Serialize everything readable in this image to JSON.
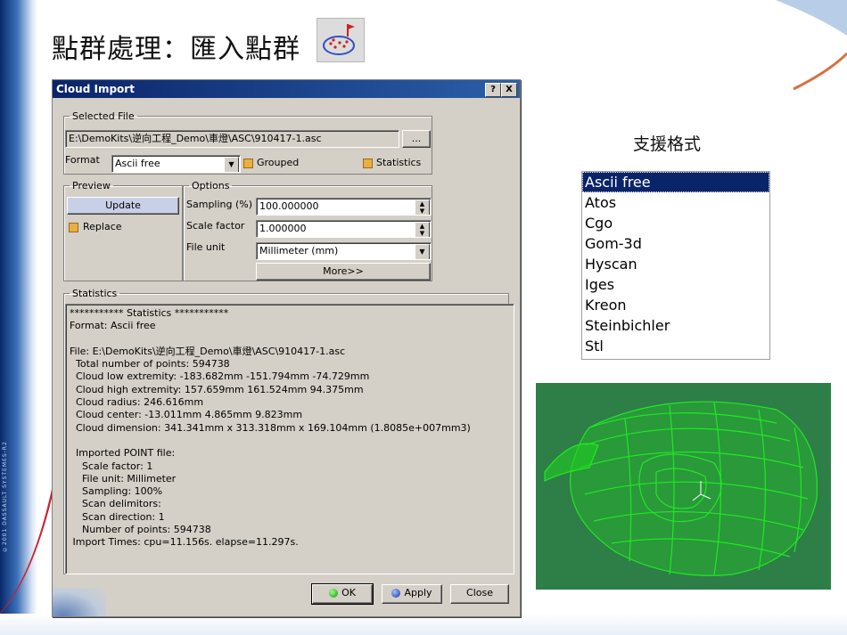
{
  "slide": {
    "title": "點群處理：匯入點群",
    "side_text": "©2001 DASSAULT SYSTEMES-R2"
  },
  "dialog": {
    "title": "Cloud Import",
    "help_label": "?",
    "close_label": "X",
    "selected_file": {
      "legend": "Selected File",
      "path": "E:\\DemoKits\\逆向工程_Demo\\車燈\\ASC\\910417-1.asc",
      "browse_label": "...",
      "format_label": "Format",
      "format_value": "Ascii free",
      "grouped_label": "Grouped",
      "statistics_label": "Statistics"
    },
    "preview": {
      "legend": "Preview",
      "update_label": "Update",
      "replace_label": "Replace"
    },
    "options": {
      "legend": "Options",
      "sampling_label": "Sampling (%)",
      "sampling_value": "100.000000",
      "scale_label": "Scale factor",
      "scale_value": "1.000000",
      "unit_label": "File unit",
      "unit_value": "Millimeter (mm)",
      "more_label": "More>>"
    },
    "statistics": {
      "legend": "Statistics",
      "text": "*********** Statistics ***********\nFormat: Ascii free\n\nFile: E:\\DemoKits\\逆向工程_Demo\\車燈\\ASC\\910417-1.asc\n  Total number of points: 594738\n  Cloud low extremity: -183.682mm -151.794mm -74.729mm\n  Cloud high extremity: 157.659mm 161.524mm 94.375mm\n  Cloud radius: 246.616mm\n  Cloud center: -13.011mm 4.865mm 9.823mm\n  Cloud dimension: 341.341mm x 313.318mm x 169.104mm (1.8085e+007mm3)\n\n  Imported POINT file:\n    Scale factor: 1\n    File unit: Millimeter\n    Sampling: 100%\n    Scan delimitors:\n    Scan direction: 1\n    Number of points: 594738\n Import Times: cpu=11.156s. elapse=11.297s."
    },
    "buttons": {
      "ok_label": "OK",
      "apply_label": "Apply",
      "close_label": "Close"
    }
  },
  "formats": {
    "title": "支援格式",
    "items": [
      "Ascii free",
      "Atos",
      "Cgo",
      "Gom-3d",
      "Hyscan",
      "Iges",
      "Kreon",
      "Steinbichler",
      "Stl"
    ],
    "selected_index": 0
  },
  "colors": {
    "titlebar": "#0a246a",
    "dialog_bg": "#d4d0c8",
    "cloud_bg": "#2e7e48",
    "cloud_points": "#22ee22",
    "check_orange": "#e8b040"
  },
  "icons": {
    "title_icon": "point-cloud-import-icon",
    "ok_ball": "green-ball-icon",
    "apply_ball": "blue-ball-icon"
  }
}
